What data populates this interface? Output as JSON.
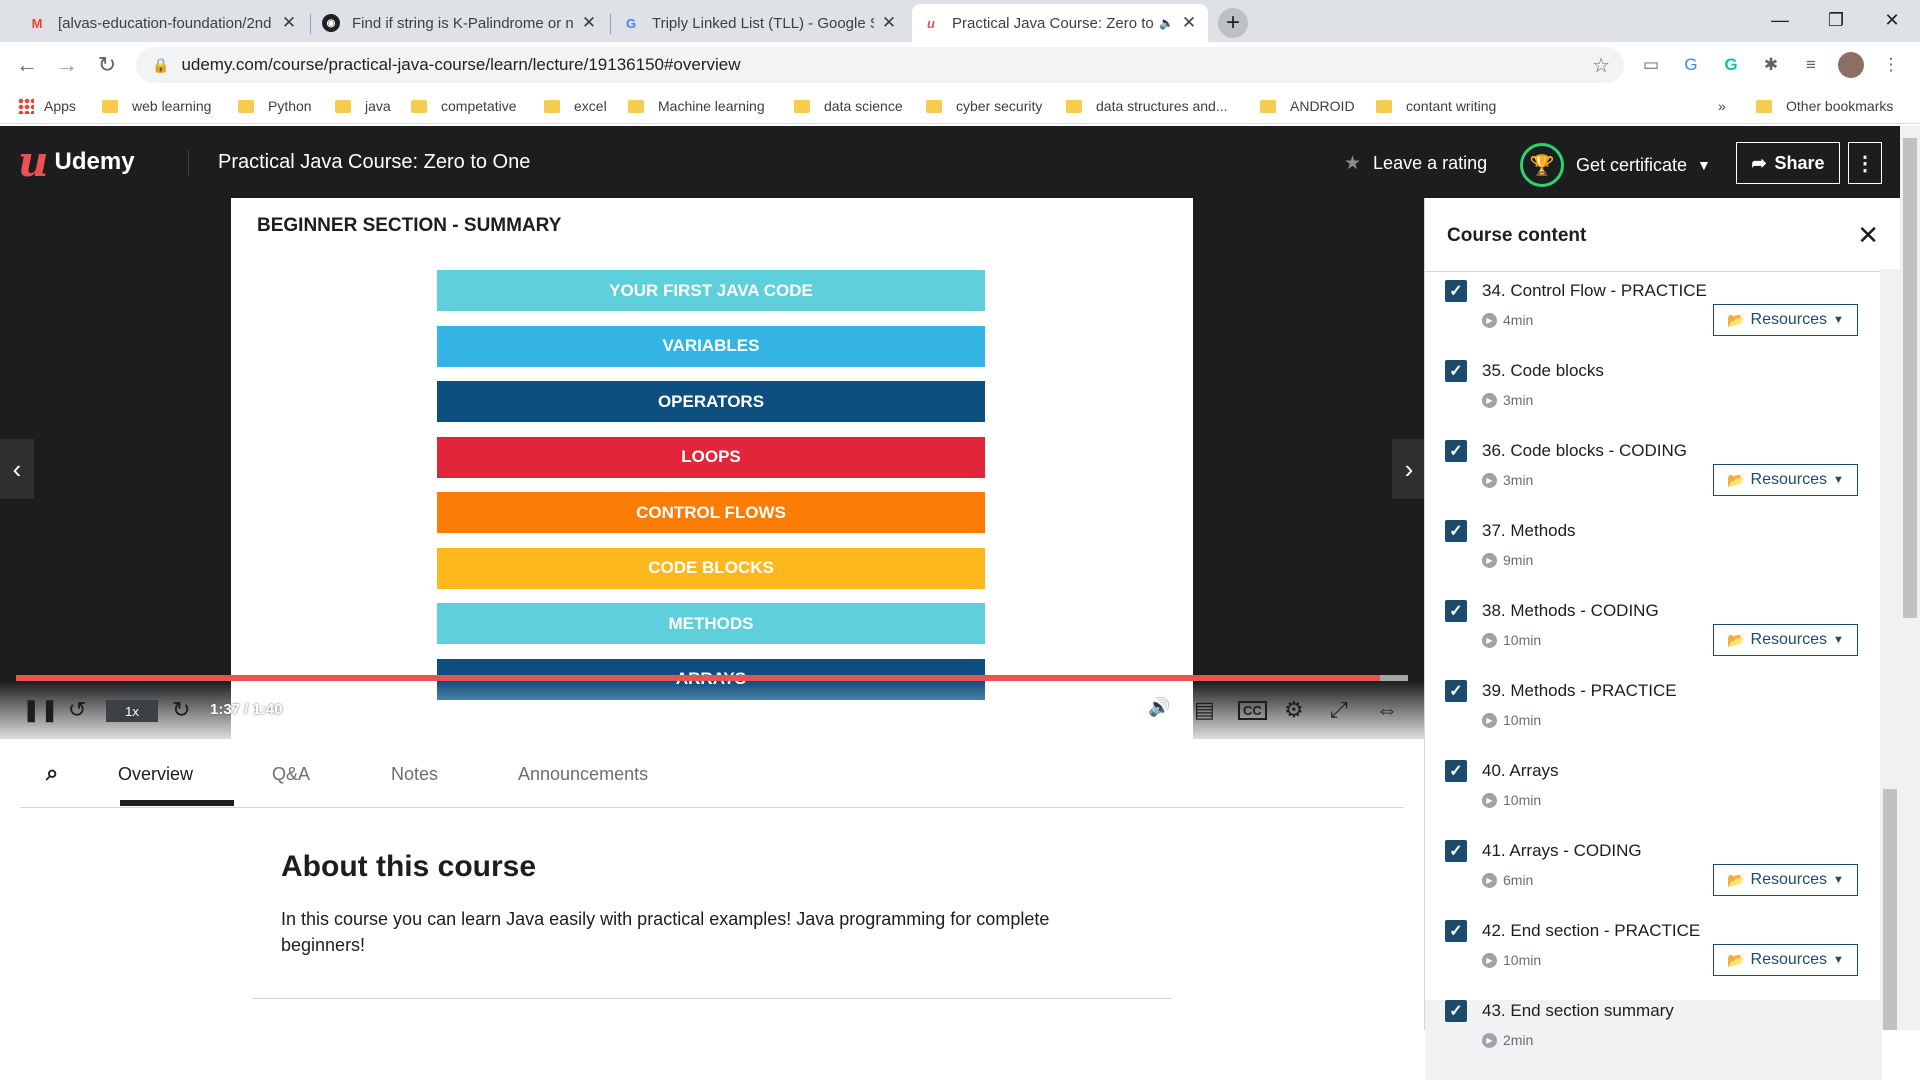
{
  "browser": {
    "tabs": [
      {
        "title": "[alvas-education-foundation/2nd",
        "icon": "gmail-icon"
      },
      {
        "title": "Find if string is K-Palindrome or n",
        "icon": "site-icon"
      },
      {
        "title": "Triply Linked List (TLL) - Google S",
        "icon": "google-icon"
      },
      {
        "title": "Practical Java Course: Zero to",
        "icon": "udemy-icon"
      }
    ],
    "url": "udemy.com/course/practical-java-course/learn/lecture/19136150#overview",
    "bookmarks": [
      "Apps",
      "web learning",
      "Python",
      "java",
      "competative",
      "excel",
      "Machine learning",
      "data science",
      "cyber security",
      "data structures and...",
      "ANDROID",
      "contant writing"
    ],
    "bookmarks_more": "»",
    "other_bookmarks": "Other bookmarks"
  },
  "header": {
    "logo": "Udemy",
    "course_title": "Practical Java Course: Zero to One",
    "rating": "Leave a rating",
    "certificate": "Get certificate",
    "share": "Share"
  },
  "video": {
    "slide_title": "BEGINNER SECTION - SUMMARY",
    "bars": [
      {
        "label": "YOUR FIRST JAVA CODE",
        "color": "#5dd0dc"
      },
      {
        "label": "VARIABLES",
        "color": "#33b4e5"
      },
      {
        "label": "OPERATORS",
        "color": "#0d4f7e"
      },
      {
        "label": "LOOPS",
        "color": "#e02638"
      },
      {
        "label": "CONTROL FLOWS",
        "color": "#fb7d06"
      },
      {
        "label": "CODE BLOCKS",
        "color": "#fdb81e"
      },
      {
        "label": "METHODS",
        "color": "#5dd0dc"
      },
      {
        "label": "ARRAYS",
        "color": "#0d4f7e"
      }
    ],
    "speed": "1x",
    "time": "1:37 / 1:40",
    "progress": 0.98
  },
  "content_tabs": [
    "Overview",
    "Q&A",
    "Notes",
    "Announcements"
  ],
  "about": {
    "title": "About this course",
    "description": "In this course you can learn Java easily with practical examples! Java programming for complete beginners!"
  },
  "sidebar": {
    "title": "Course content",
    "items": [
      {
        "name": "34. Control Flow - PRACTICE",
        "duration": "4min",
        "resources": "Resources"
      },
      {
        "name": "35. Code blocks",
        "duration": "3min",
        "resources": ""
      },
      {
        "name": "36. Code blocks - CODING",
        "duration": "3min",
        "resources": "Resources"
      },
      {
        "name": "37. Methods",
        "duration": "9min",
        "resources": ""
      },
      {
        "name": "38. Methods - CODING",
        "duration": "10min",
        "resources": "Resources"
      },
      {
        "name": "39. Methods - PRACTICE",
        "duration": "10min",
        "resources": ""
      },
      {
        "name": "40. Arrays",
        "duration": "10min",
        "resources": ""
      },
      {
        "name": "41. Arrays - CODING",
        "duration": "6min",
        "resources": "Resources"
      },
      {
        "name": "42. End section - PRACTICE",
        "duration": "10min",
        "resources": "Resources"
      },
      {
        "name": "43. End section summary",
        "duration": "2min",
        "resources": ""
      }
    ]
  }
}
